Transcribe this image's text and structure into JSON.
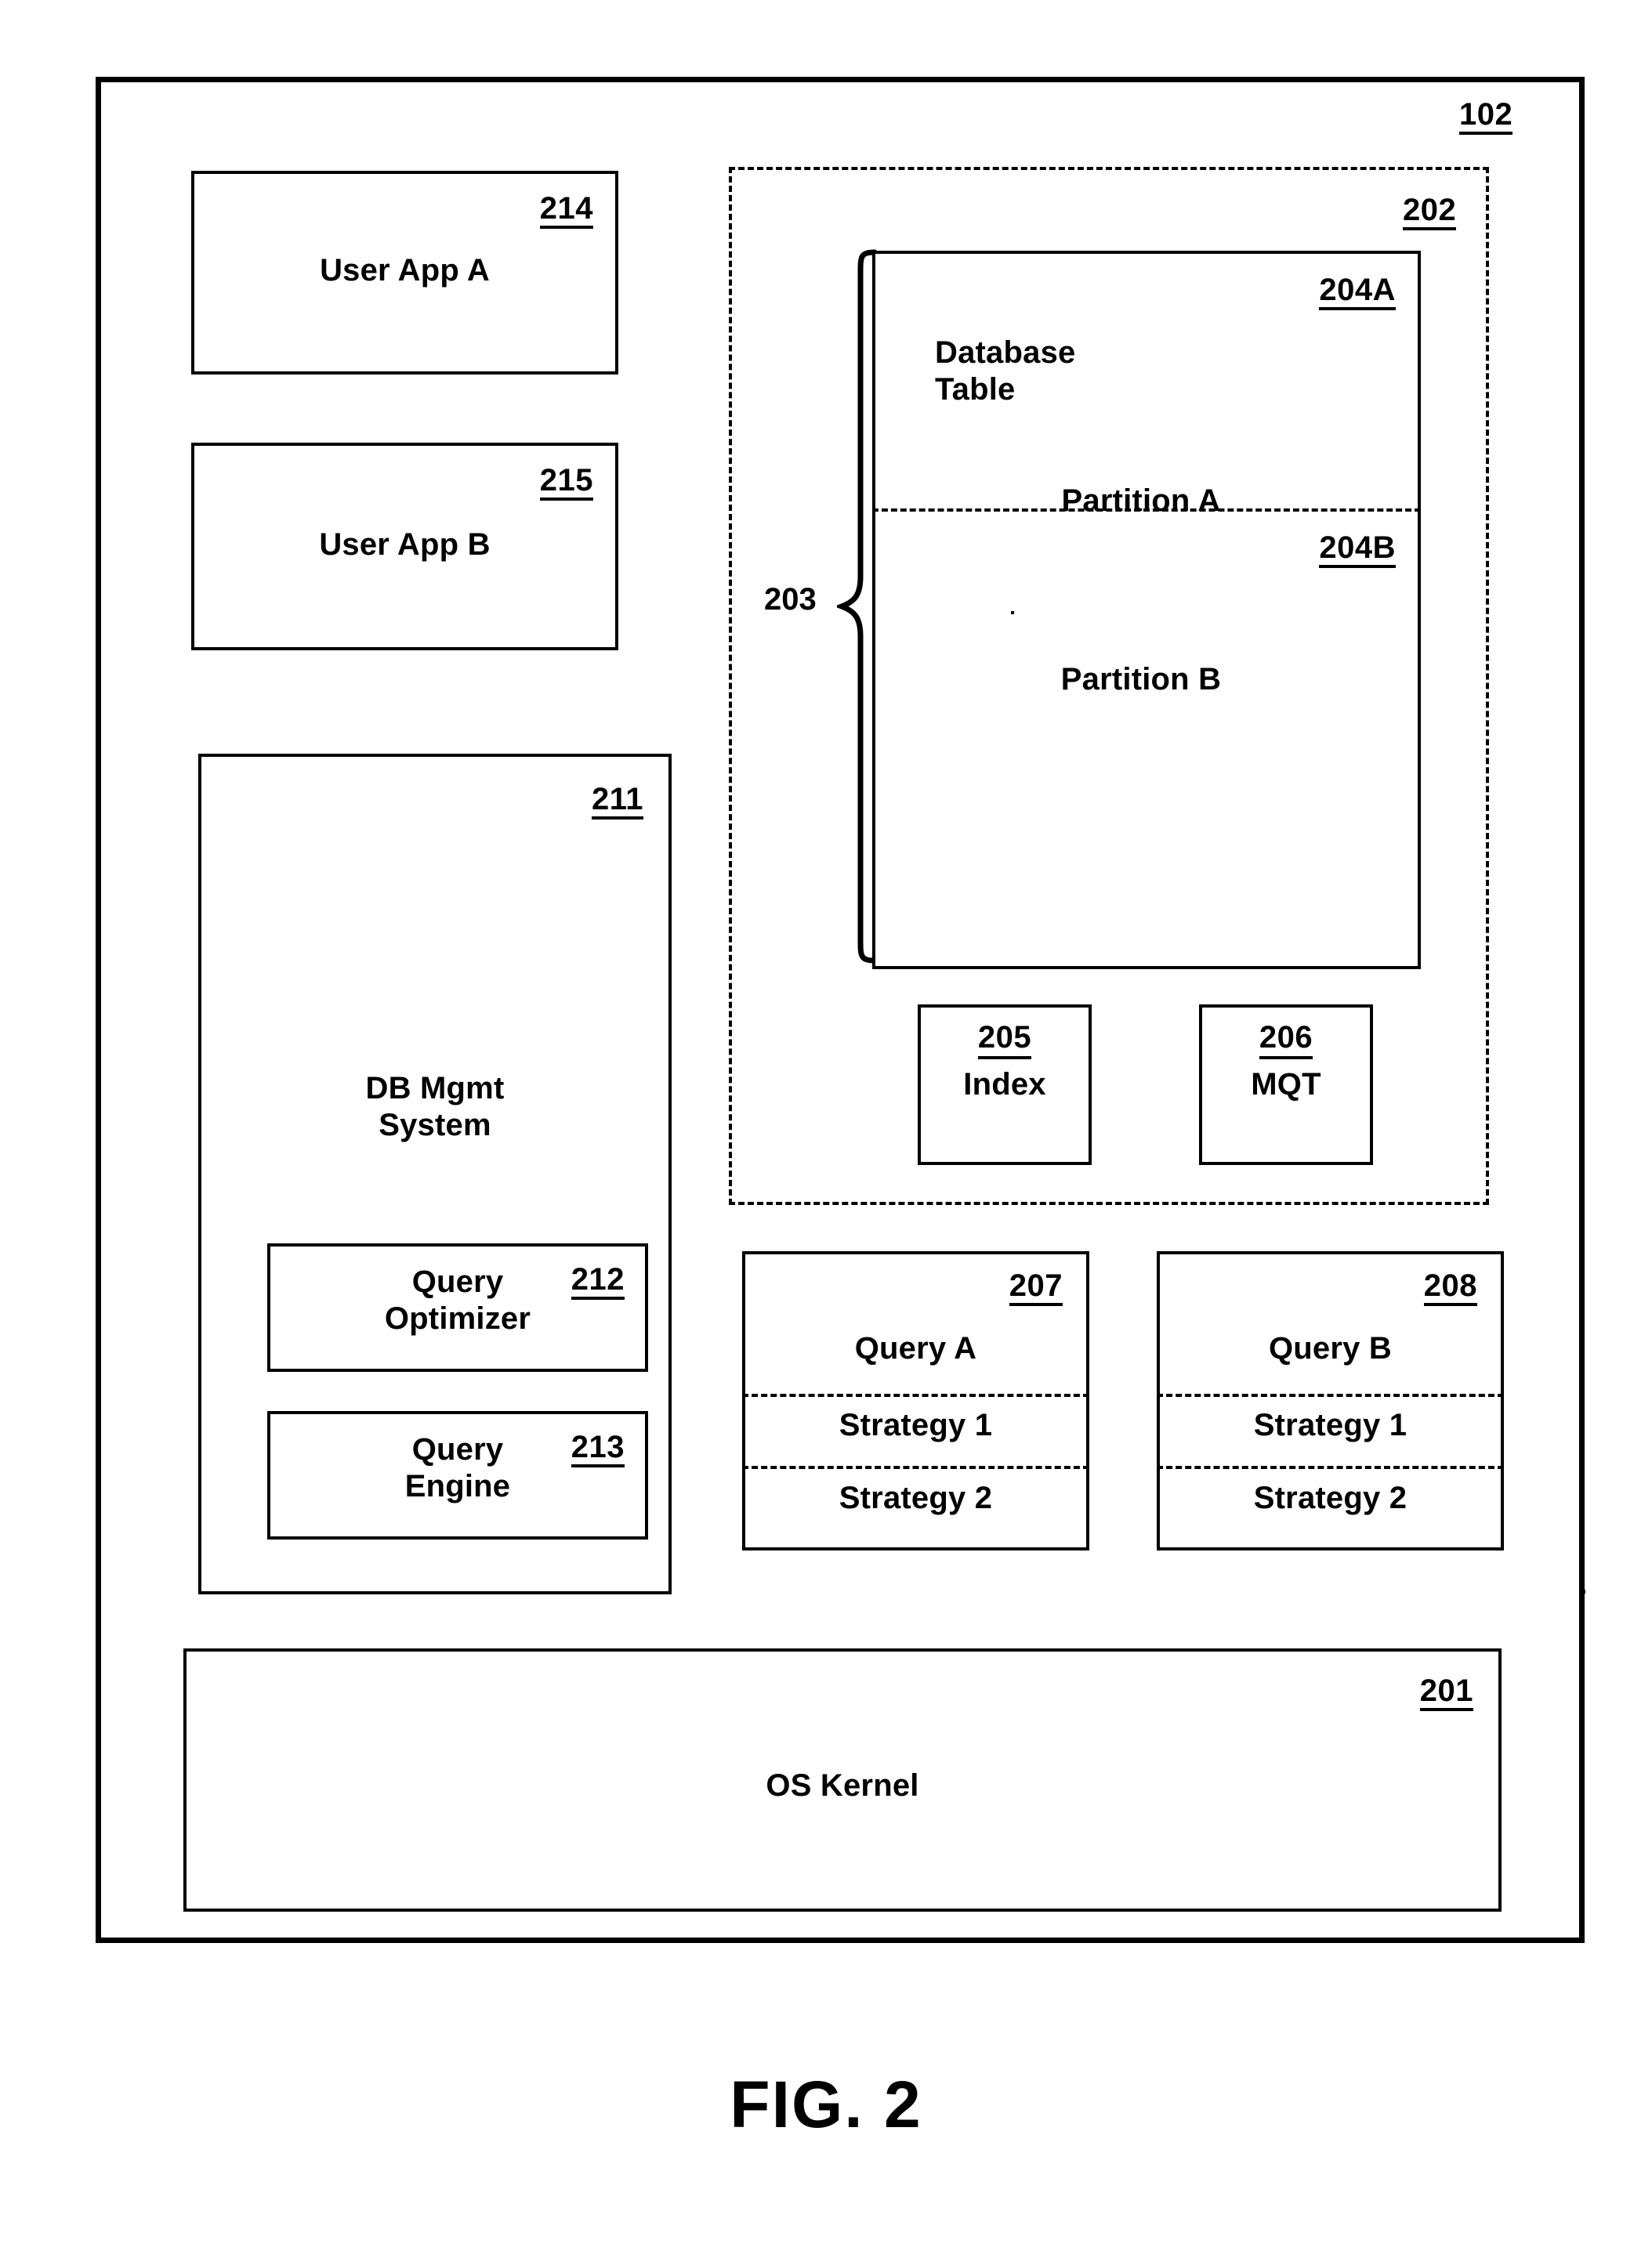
{
  "figure": {
    "caption": "FIG. 2"
  },
  "system": {
    "ref": "102",
    "os_kernel": {
      "ref": "201",
      "label": "OS Kernel"
    },
    "user_apps": [
      {
        "ref": "214",
        "label": "User App A"
      },
      {
        "ref": "215",
        "label": "User App B"
      }
    ],
    "dbms": {
      "ref": "211",
      "label": "DB Mgmt\nSystem",
      "components": [
        {
          "ref": "212",
          "label": "Query\nOptimizer"
        },
        {
          "ref": "213",
          "label": "Query\nEngine"
        }
      ]
    },
    "database": {
      "ref": "202",
      "table": {
        "label": "Database\nTable",
        "partition_group_ref": "203",
        "partitions": [
          {
            "ref": "204A",
            "label": "Partition A"
          },
          {
            "ref": "204B",
            "label": "Partition B"
          }
        ]
      },
      "auxiliary": [
        {
          "ref": "205",
          "label": "Index"
        },
        {
          "ref": "206",
          "label": "MQT"
        }
      ]
    },
    "queries": [
      {
        "ref": "207",
        "label": "Query A",
        "strategies": [
          "Strategy 1",
          "Strategy 2"
        ]
      },
      {
        "ref": "208",
        "label": "Query B",
        "strategies": [
          "Strategy 1",
          "Strategy 2"
        ]
      }
    ]
  }
}
